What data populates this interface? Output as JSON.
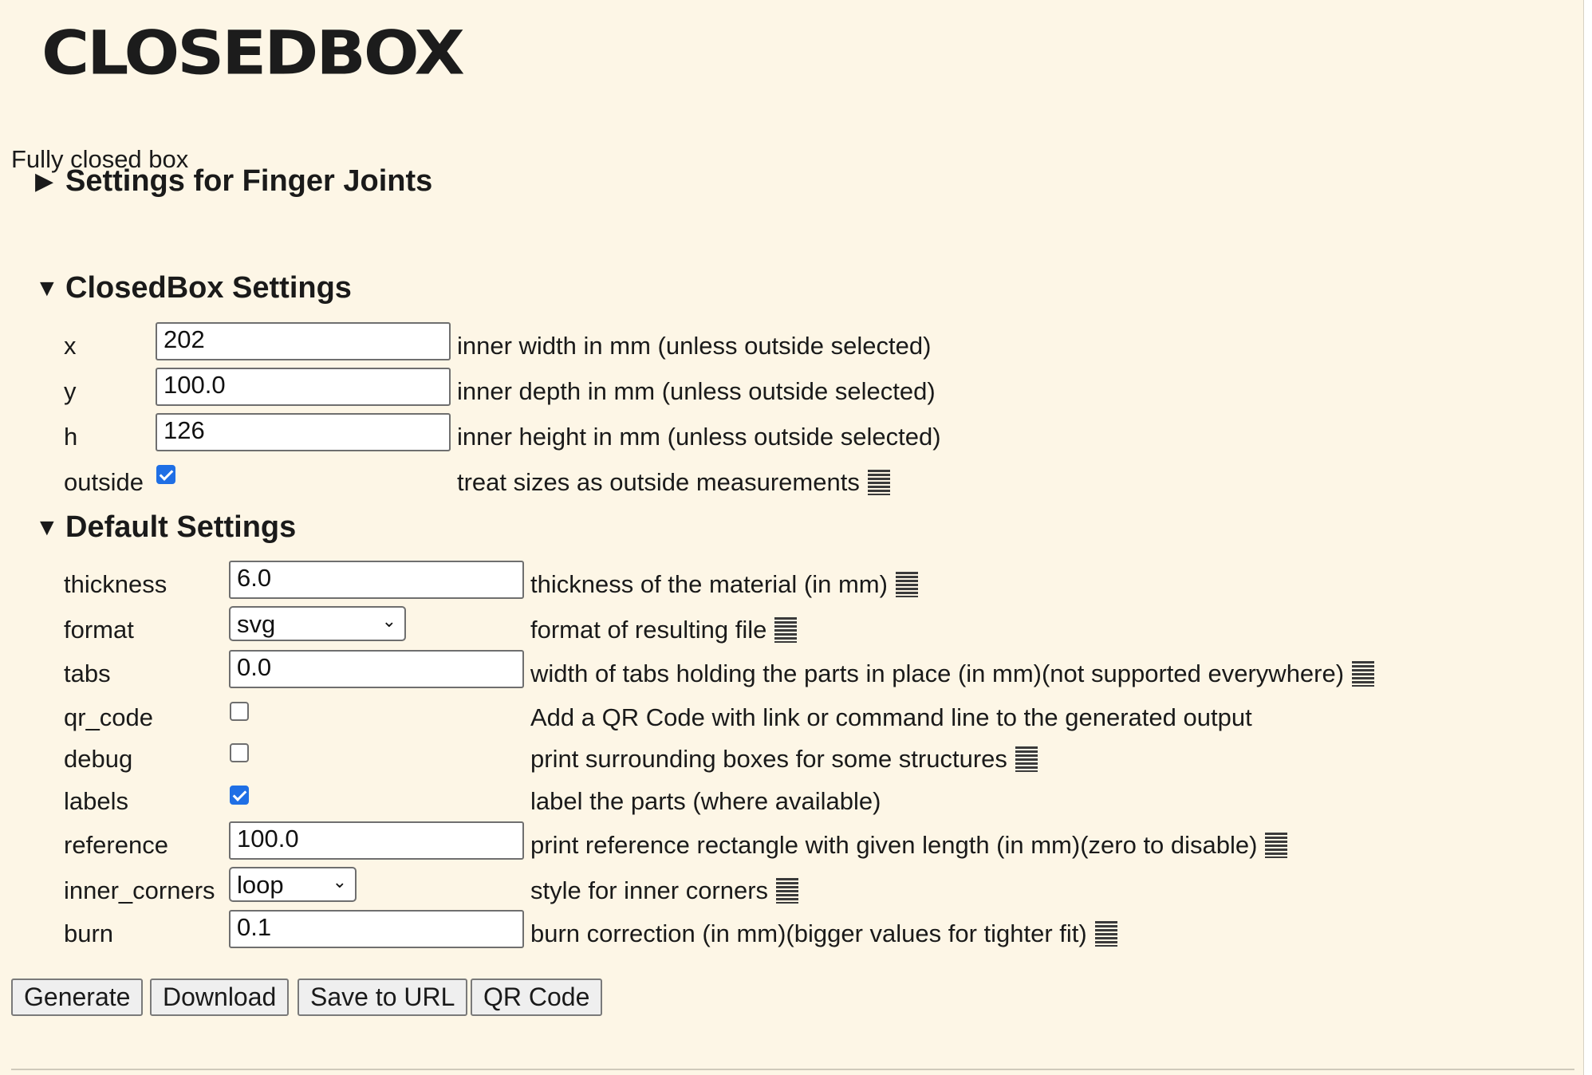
{
  "app": {
    "logo_text": "CLOSEDBOX",
    "description": "Fully closed box"
  },
  "sections": {
    "finger_joints": {
      "title": "Settings for Finger Joints",
      "expanded": false
    },
    "closedbox": {
      "title": "ClosedBox Settings",
      "expanded": true,
      "fields": [
        {
          "label": "x",
          "value": "202",
          "help": "inner width in mm (unless outside selected)"
        },
        {
          "label": "y",
          "value": "100.0",
          "help": "inner depth in mm (unless outside selected)"
        },
        {
          "label": "h",
          "value": "126",
          "help": "inner height in mm (unless outside selected)"
        },
        {
          "label": "outside",
          "checked": true,
          "help": "treat sizes as outside measurements"
        }
      ]
    },
    "default": {
      "title": "Default Settings",
      "expanded": true,
      "fields": [
        {
          "label": "thickness",
          "value": "6.0",
          "help": "thickness of the material (in mm)"
        },
        {
          "label": "format",
          "value": "svg",
          "help": "format of resulting file"
        },
        {
          "label": "tabs",
          "value": "0.0",
          "help": "width of tabs holding the parts in place (in mm)(not supported everywhere)"
        },
        {
          "label": "qr_code",
          "checked": false,
          "help": "Add a QR Code with link or command line to the generated output"
        },
        {
          "label": "debug",
          "checked": false,
          "help": "print surrounding boxes for some structures"
        },
        {
          "label": "labels",
          "checked": true,
          "help": "label the parts (where available)"
        },
        {
          "label": "reference",
          "value": "100.0",
          "help": "print reference rectangle with given length (in mm)(zero to disable)"
        },
        {
          "label": "inner_corners",
          "value": "loop",
          "help": "style for inner corners"
        },
        {
          "label": "burn",
          "value": "0.1",
          "help": "burn correction (in mm)(bigger values for tighter fit)"
        }
      ]
    }
  },
  "buttons": {
    "generate": "Generate",
    "download": "Download",
    "save_url": "Save to URL",
    "qr_code": "QR Code"
  },
  "icons": {
    "collapsed": "triangle-right-icon",
    "expanded": "triangle-down-icon",
    "help": "menu-lines-icon",
    "select": "chevron-down-icon"
  },
  "colors": {
    "background": "#fdf6e6",
    "checkbox_accent": "#1f6fe5"
  }
}
